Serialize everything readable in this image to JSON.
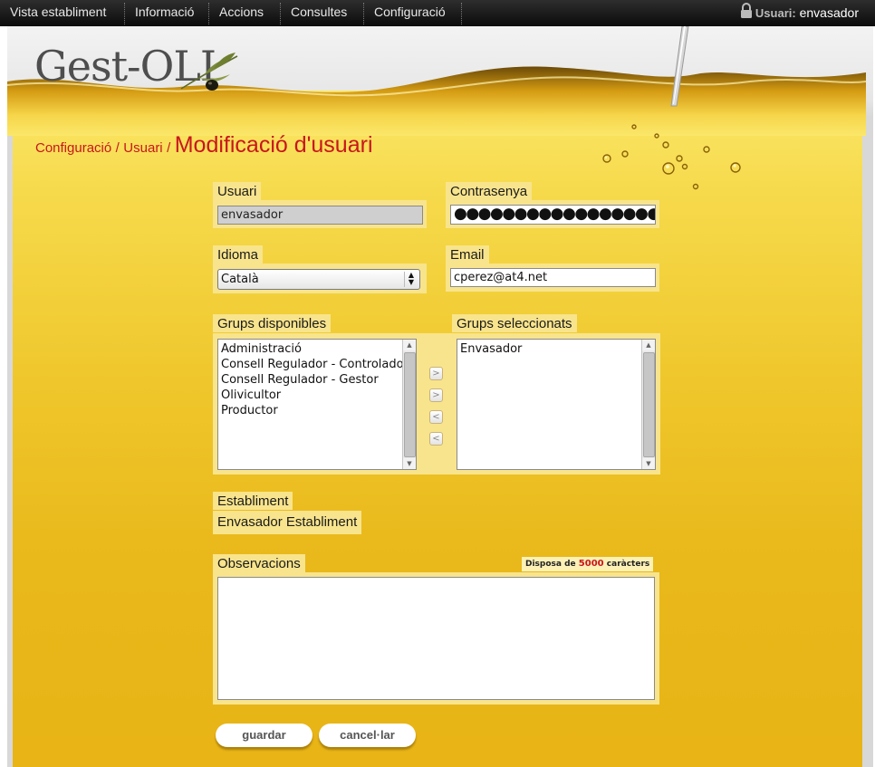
{
  "nav": {
    "items": [
      "Vista establiment",
      "Informació",
      "Accions",
      "Consultes",
      "Configuració"
    ],
    "user_prefix": "Usuari:",
    "user_name": "envasador"
  },
  "logo": {
    "text": "Gest-OLI"
  },
  "breadcrumb": {
    "crumb1": "Configuració",
    "crumb2": "Usuari",
    "separator": "/",
    "title": "Modificació d'usuari"
  },
  "form": {
    "usuari": {
      "label": "Usuari",
      "value": "envasador"
    },
    "contrasenya": {
      "label": "Contrasenya",
      "value": "●●●●●●●●●●●●●●●●●●●●●"
    },
    "idioma": {
      "label": "Idioma",
      "value": "Català"
    },
    "email": {
      "label": "Email",
      "value": "cperez@at4.net"
    },
    "grups_disponibles": {
      "label": "Grups disponibles",
      "options": [
        "Administració",
        "Consell Regulador - Controlador",
        "Consell Regulador - Gestor",
        "Olivicultor",
        "Productor"
      ]
    },
    "grups_seleccionats": {
      "label": "Grups seleccionats",
      "options": [
        "Envasador"
      ]
    },
    "move_buttons": [
      ">",
      ">",
      "<",
      "<"
    ],
    "establiment": {
      "label": "Establiment",
      "value": "Envasador Establiment"
    },
    "observacions": {
      "label": "Observacions",
      "counter_prefix": "Disposa de",
      "counter_value": "5000",
      "counter_suffix": "caràcters"
    },
    "buttons": {
      "save": "guardar",
      "cancel": "cancel·lar"
    }
  },
  "colors": {
    "accent_red": "#c8161d",
    "label_bg": "#f8e48c",
    "oil_yellow": "#efc72c",
    "nav_bg": "#1c1c1c"
  }
}
